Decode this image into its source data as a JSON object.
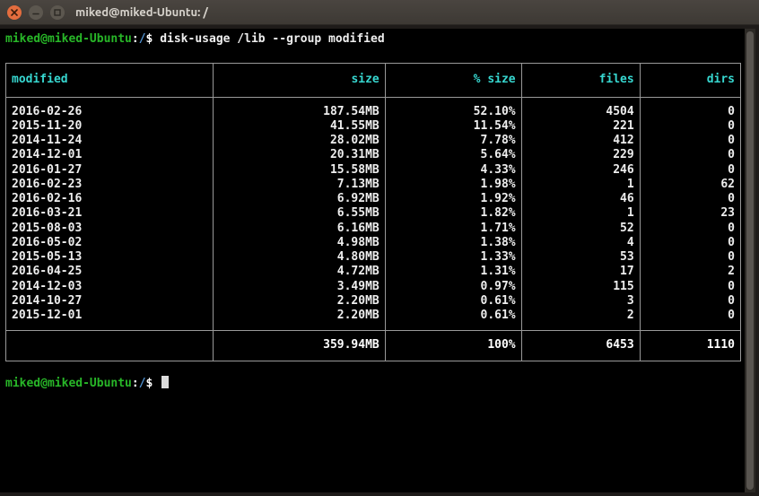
{
  "window": {
    "title": "miked@miked-Ubuntu: /"
  },
  "prompt1": {
    "user": "miked@miked-Ubuntu",
    "path": "/",
    "command": "disk-usage /lib --group modified"
  },
  "prompt2": {
    "user": "miked@miked-Ubuntu",
    "path": "/",
    "command": ""
  },
  "table": {
    "headers": {
      "modified": "modified",
      "size": "size",
      "pct_size": "% size",
      "files": "files",
      "dirs": "dirs"
    },
    "rows": [
      {
        "modified": "2016-02-26",
        "size": "187.54MB",
        "pct": "52.10%",
        "files": "4504",
        "dirs": "0"
      },
      {
        "modified": "2015-11-20",
        "size": "41.55MB",
        "pct": "11.54%",
        "files": "221",
        "dirs": "0"
      },
      {
        "modified": "2014-11-24",
        "size": "28.02MB",
        "pct": "7.78%",
        "files": "412",
        "dirs": "0"
      },
      {
        "modified": "2014-12-01",
        "size": "20.31MB",
        "pct": "5.64%",
        "files": "229",
        "dirs": "0"
      },
      {
        "modified": "2016-01-27",
        "size": "15.58MB",
        "pct": "4.33%",
        "files": "246",
        "dirs": "0"
      },
      {
        "modified": "2016-02-23",
        "size": "7.13MB",
        "pct": "1.98%",
        "files": "1",
        "dirs": "62"
      },
      {
        "modified": "2016-02-16",
        "size": "6.92MB",
        "pct": "1.92%",
        "files": "46",
        "dirs": "0"
      },
      {
        "modified": "2016-03-21",
        "size": "6.55MB",
        "pct": "1.82%",
        "files": "1",
        "dirs": "23"
      },
      {
        "modified": "2015-08-03",
        "size": "6.16MB",
        "pct": "1.71%",
        "files": "52",
        "dirs": "0"
      },
      {
        "modified": "2016-05-02",
        "size": "4.98MB",
        "pct": "1.38%",
        "files": "4",
        "dirs": "0"
      },
      {
        "modified": "2015-05-13",
        "size": "4.80MB",
        "pct": "1.33%",
        "files": "53",
        "dirs": "0"
      },
      {
        "modified": "2016-04-25",
        "size": "4.72MB",
        "pct": "1.31%",
        "files": "17",
        "dirs": "2"
      },
      {
        "modified": "2014-12-03",
        "size": "3.49MB",
        "pct": "0.97%",
        "files": "115",
        "dirs": "0"
      },
      {
        "modified": "2014-10-27",
        "size": "2.20MB",
        "pct": "0.61%",
        "files": "3",
        "dirs": "0"
      },
      {
        "modified": "2015-12-01",
        "size": "2.20MB",
        "pct": "0.61%",
        "files": "2",
        "dirs": "0"
      }
    ],
    "totals": {
      "modified": "",
      "size": "359.94MB",
      "pct": "100%",
      "files": "6453",
      "dirs": "1110"
    }
  }
}
